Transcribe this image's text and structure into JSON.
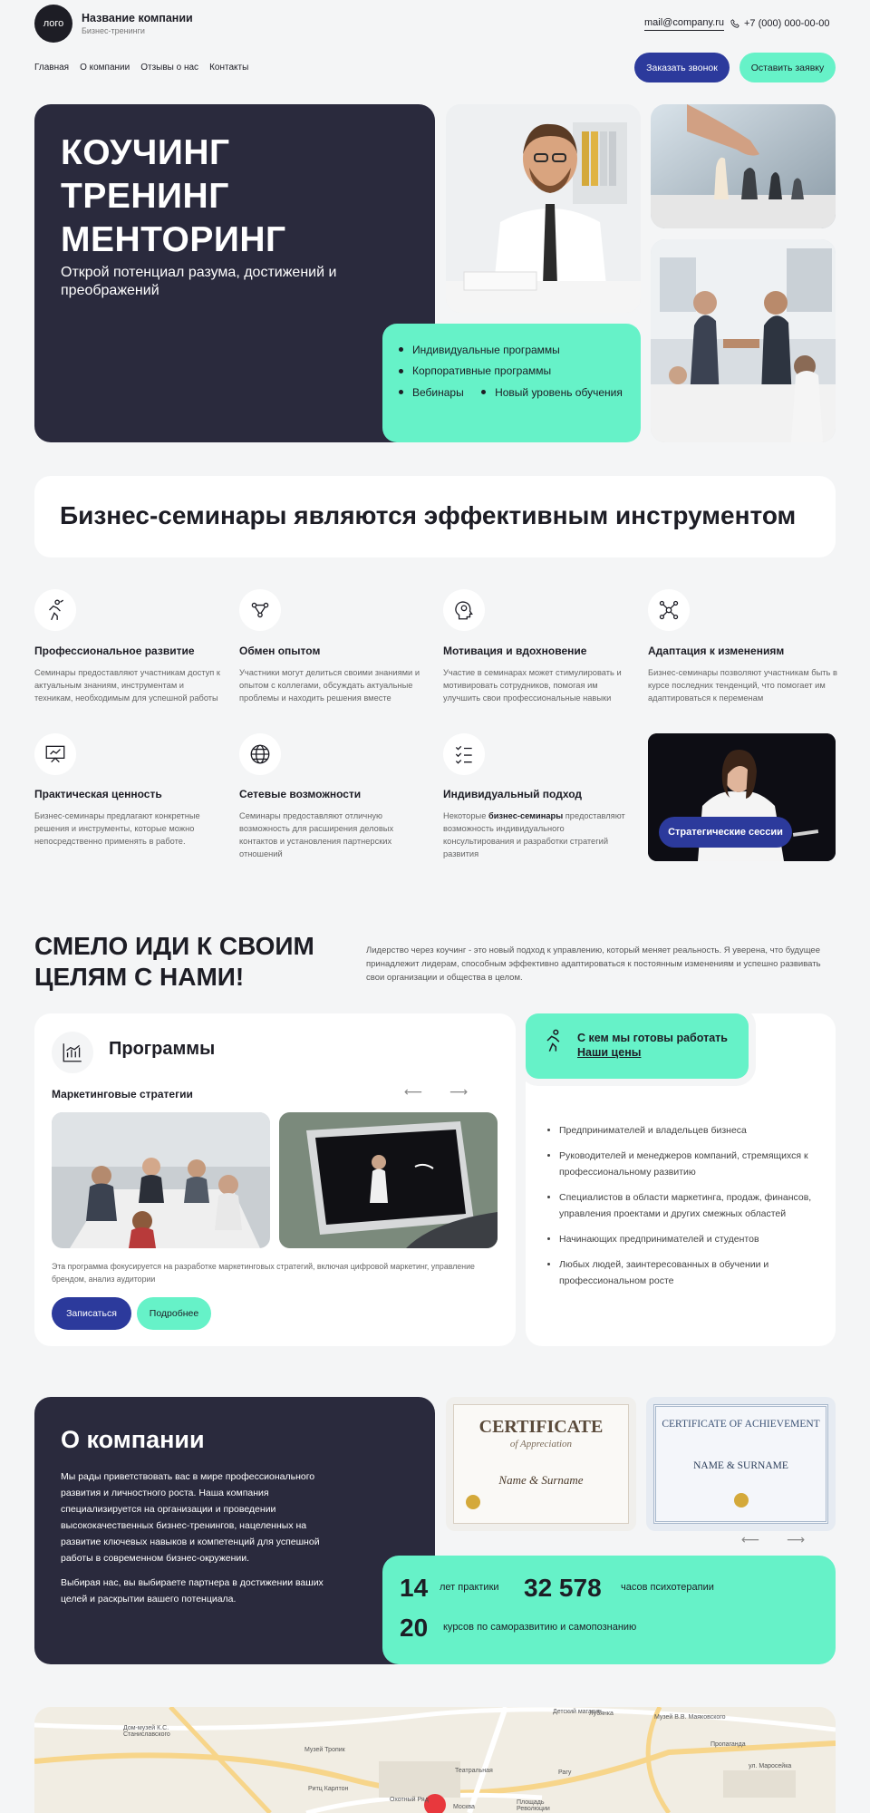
{
  "header": {
    "logo": "лого",
    "company_name": "Название компании",
    "company_sub": "Бизнес-тренинги",
    "email": "mail@company.ru",
    "phone": "+7 (000) 000-00-00",
    "nav": [
      "Главная",
      "О компании",
      "Отзывы о нас",
      "Контакты"
    ],
    "call_button": "Заказать звонок",
    "request_button": "Оставить заявку"
  },
  "hero": {
    "title_lines": [
      "КОУЧИНГ",
      "ТРЕНИНГ",
      "МЕНТОРИНГ"
    ],
    "subtitle": "Открой потенциал разума, достижений и преображений",
    "list": [
      "Индивидуальные программы",
      "Корпоративные программы",
      "Вебинары",
      "Новый уровень обучения"
    ]
  },
  "banner": {
    "text": "Бизнес-семинары являются эффективным инструментом"
  },
  "features": [
    {
      "icon": "runner-icon",
      "title": "Профессиональное развитие",
      "text": "Семинары предоставляют участникам доступ к актуальным знаниям, инструментам и техникам, необходимым для успешной работы"
    },
    {
      "icon": "exchange-icon",
      "title": "Обмен опытом",
      "text": "Участники могут делиться своими знаниями и опытом с коллегами, обсуждать актуальные проблемы и находить решения вместе"
    },
    {
      "icon": "head-icon",
      "title": "Мотивация и вдохновение",
      "text": "Участие в семинарах может стимулировать и мотивировать сотрудников, помогая им улучшить свои профессиональные навыки"
    },
    {
      "icon": "network-icon",
      "title": "Адаптация к изменениям",
      "text": "Бизнес-семинары позволяют участникам быть в курсе последних тенденций, что помогает им адаптироваться к переменам"
    },
    {
      "icon": "presentation-icon",
      "title": "Практическая ценность",
      "text": "Бизнес-семинары предлагают конкретные решения и инструменты, которые можно непосредственно применять в работе."
    },
    {
      "icon": "globe-icon",
      "title": "Сетевые возможности",
      "text": "Семинары предоставляют отличную возможность для расширения деловых контактов и установления партнерских отношений"
    },
    {
      "icon": "checklist-icon",
      "title": "Индивидуальный подход",
      "text_before": "Некоторые ",
      "text_bold": "бизнес-семинары",
      "text_after": " предоставляют возможность индивидуального консультирования и разработки стратегий развития"
    }
  ],
  "strategic_sessions": "Стратегические сессии",
  "goals": {
    "title_lines": [
      "СМЕЛО ИДИ К СВОИМ",
      "ЦЕЛЯМ С НАМИ!"
    ],
    "lead": "Лидерство через коучинг - это новый подход к управлению, который меняет реальность. Я уверена, что будущее принадлежит лидерам, способным эффективно адаптироваться к постоянным изменениям и успешно развивать свои организации и общества в целом."
  },
  "programs": {
    "title": "Программы",
    "subtitle": "Маркетинговые стратегии",
    "description": "Эта программа фокусируется на разработке маркетинговых стратегий, включая цифровой маркетинг, управление брендом, анализ аудитории",
    "enroll_button": "Записаться",
    "more_button": "Подробнее"
  },
  "audience": {
    "title": "С кем мы готовы работать",
    "link": "Наши цены",
    "items": [
      "Предпринимателей и владельцев бизнеса",
      "Руководителей и менеджеров компаний, стремящихся к профессиональному развитию",
      "Специалистов в области маркетинга, продаж, финансов, управления проектами и других смежных областей",
      "Начинающих предпринимателей и студентов",
      "Любых людей, заинтересованных в обучении и профессиональном росте"
    ]
  },
  "about": {
    "title": "О компании",
    "p1": "Мы рады приветствовать вас в мире профессионального развития и личностного роста. Наша компания специализируется на организации и проведении высококачественных бизнес-тренингов, нацеленных на развитие ключевых навыков и компетенций для успешной работы в современном бизнес-окружении.",
    "p2": "Выбирая нас, вы выбираете партнера в достижении ваших целей и раскрытии вашего потенциала."
  },
  "certificates": [
    {
      "title": "CERTIFICATE",
      "sub": "of Appreciation",
      "name": "Name & Surname"
    },
    {
      "title": "CERTIFICATE OF ACHIEVEMENT",
      "name": "NAME & SURNAME"
    }
  ],
  "stats": {
    "years_num": "14",
    "years_label": "лет практики",
    "hours_num": "32 578",
    "hours_label": "часов психотерапии",
    "courses_num": "20",
    "courses_label": "курсов по саморазвитию и самопознанию"
  },
  "map": {
    "labels": [
      "Дом-музей К.С. Станиславского",
      "Детский магазин",
      "Лубянка",
      "Музей В.В. Маяковского",
      "Пропаганда",
      "ул. Маросейка",
      "Театральная",
      "Рагу",
      "Москва",
      "Охотный Ряд",
      "Ритц Карлтон",
      "Музей Тропик",
      "Площадь Революции"
    ]
  },
  "colors": {
    "dark": "#2a2a3d",
    "mint": "#66f2c8",
    "blue": "#2c3a9c"
  }
}
